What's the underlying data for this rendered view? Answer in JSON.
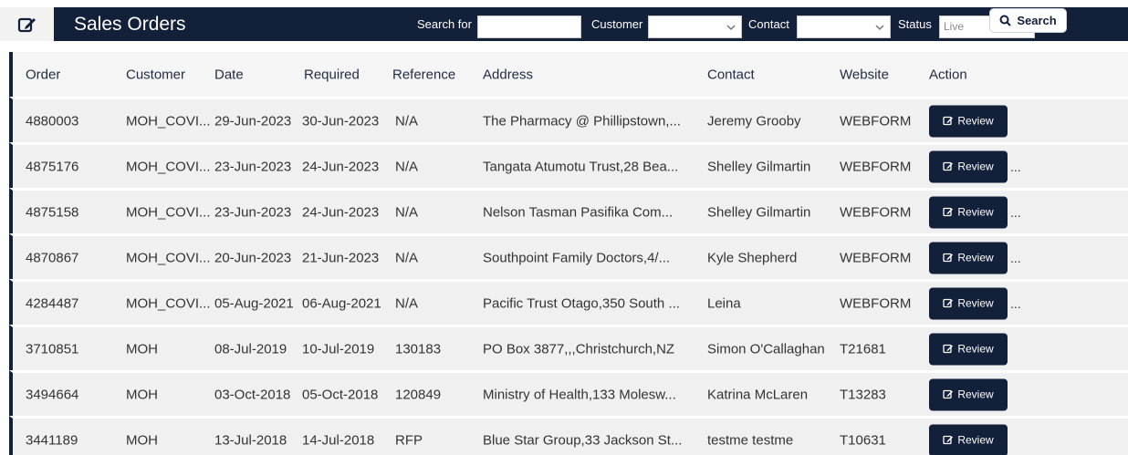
{
  "header": {
    "title": "Sales Orders",
    "search_label": "Search for",
    "search_value": "",
    "customer_label": "Customer",
    "customer_value": "",
    "contact_label": "Contact",
    "contact_value": "",
    "status_label": "Status",
    "status_value": "Live",
    "search_button": "Search"
  },
  "columns": [
    "Order",
    "Customer",
    "Date",
    "Required",
    "Reference",
    "Address",
    "Contact",
    "Website",
    "Action"
  ],
  "rows": [
    {
      "order": "4880003",
      "customer": "MOH_COVI...",
      "date": "29-Jun-2023",
      "required": "30-Jun-2023",
      "reference": "N/A",
      "address": "The Pharmacy @ Phillipstown,...",
      "contact": "Jeremy Grooby",
      "website": "WEBFORM",
      "action": "Review",
      "more": ""
    },
    {
      "order": "4875176",
      "customer": "MOH_COVI...",
      "date": "23-Jun-2023",
      "required": "24-Jun-2023",
      "reference": "N/A",
      "address": "Tangata Atumotu Trust,28 Bea...",
      "contact": "Shelley Gilmartin",
      "website": "WEBFORM",
      "action": "Review",
      "more": "..."
    },
    {
      "order": "4875158",
      "customer": "MOH_COVI...",
      "date": "23-Jun-2023",
      "required": "24-Jun-2023",
      "reference": "N/A",
      "address": "Nelson Tasman Pasifika Com...",
      "contact": "Shelley Gilmartin",
      "website": "WEBFORM",
      "action": "Review",
      "more": "..."
    },
    {
      "order": "4870867",
      "customer": "MOH_COVI...",
      "date": "20-Jun-2023",
      "required": "21-Jun-2023",
      "reference": "N/A",
      "address": "Southpoint Family Doctors,4/...",
      "contact": "Kyle Shepherd",
      "website": "WEBFORM",
      "action": "Review",
      "more": "..."
    },
    {
      "order": "4284487",
      "customer": "MOH_COVI...",
      "date": "05-Aug-2021",
      "required": "06-Aug-2021",
      "reference": "N/A",
      "address": "Pacific Trust Otago,350 South ...",
      "contact": "Leina",
      "website": "WEBFORM",
      "action": "Review",
      "more": "..."
    },
    {
      "order": "3710851",
      "customer": "MOH",
      "date": "08-Jul-2019",
      "required": "10-Jul-2019",
      "reference": "130183",
      "address": "PO Box 3877,,,Christchurch,NZ",
      "contact": "Simon O'Callaghan",
      "website": "T21681",
      "action": "Review",
      "more": ""
    },
    {
      "order": "3494664",
      "customer": "MOH",
      "date": "03-Oct-2018",
      "required": "05-Oct-2018",
      "reference": "120849",
      "address": "Ministry of Health,133 Molesw...",
      "contact": "Katrina McLaren",
      "website": "T13283",
      "action": "Review",
      "more": ""
    },
    {
      "order": "3441189",
      "customer": "MOH",
      "date": "13-Jul-2018",
      "required": "14-Jul-2018",
      "reference": "RFP",
      "address": "Blue Star Group,33 Jackson St...",
      "contact": "testme testme",
      "website": "T10631",
      "action": "Review",
      "more": ""
    }
  ]
}
